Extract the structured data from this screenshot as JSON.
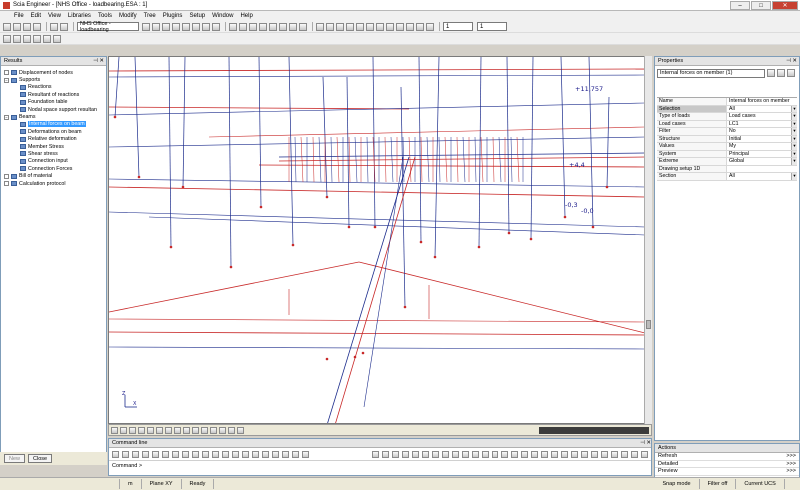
{
  "window": {
    "title": "Scia Engineer - [NHS Office - loadbearing.ESA : 1]",
    "min": "–",
    "max": "□",
    "close": "✕"
  },
  "menu": [
    "File",
    "Edit",
    "View",
    "Libraries",
    "Tools",
    "Modify",
    "Tree",
    "Plugins",
    "Setup",
    "Window",
    "Help"
  ],
  "toolbar": {
    "project_combo": "NHS Office - loadbearing",
    "spin1": "1",
    "spin2": "1"
  },
  "results_panel": {
    "title": "Results",
    "items": [
      {
        "label": "Displacement of nodes",
        "level": 0,
        "exp": ""
      },
      {
        "label": "Supports",
        "level": 0,
        "exp": "−"
      },
      {
        "label": "Reactions",
        "level": 1,
        "exp": ""
      },
      {
        "label": "Resultant of reactions",
        "level": 1,
        "exp": ""
      },
      {
        "label": "Foundation table",
        "level": 1,
        "exp": ""
      },
      {
        "label": "Nodal space support resultan",
        "level": 1,
        "exp": ""
      },
      {
        "label": "Beams",
        "level": 0,
        "exp": "−"
      },
      {
        "label": "Internal forces on beam",
        "level": 1,
        "exp": "",
        "selected": true
      },
      {
        "label": "Deformations on beam",
        "level": 1,
        "exp": ""
      },
      {
        "label": "Relative deformation",
        "level": 1,
        "exp": ""
      },
      {
        "label": "Member Stress",
        "level": 1,
        "exp": ""
      },
      {
        "label": "Shear stress",
        "level": 1,
        "exp": ""
      },
      {
        "label": "Connection input",
        "level": 1,
        "exp": ""
      },
      {
        "label": "Connection Forces",
        "level": 1,
        "exp": ""
      },
      {
        "label": "Bill of material",
        "level": 0,
        "exp": ""
      },
      {
        "label": "Calculation protocol",
        "level": 0,
        "exp": ""
      }
    ],
    "new_button": "New",
    "close_button": "Close"
  },
  "viewport": {
    "labels": [
      "+11,757",
      "-0,3",
      "-0,0",
      "+4,4"
    ],
    "axis_z": "Z",
    "axis_x": "X"
  },
  "command_line": {
    "title": "Command line",
    "prompt": "Command >"
  },
  "properties": {
    "title": "Properties",
    "selector": "Internal forces on member (1)",
    "rows": [
      {
        "key": "Name",
        "value": "Internal forces on member",
        "dd": false,
        "hl": false
      },
      {
        "key": "Selection",
        "value": "All",
        "dd": true,
        "hl": true
      },
      {
        "key": "Type of loads",
        "value": "Load cases",
        "dd": true,
        "hl": false
      },
      {
        "key": "Load cases",
        "value": "LC1",
        "dd": true,
        "hl": false
      },
      {
        "key": "Filter",
        "value": "No",
        "dd": true,
        "hl": false
      },
      {
        "key": "Structure",
        "value": "Initial",
        "dd": true,
        "hl": false
      },
      {
        "key": "Values",
        "value": "My",
        "dd": true,
        "hl": false
      },
      {
        "key": "System",
        "value": "Principal",
        "dd": true,
        "hl": false
      },
      {
        "key": "Extreme",
        "value": "Global",
        "dd": true,
        "hl": false
      },
      {
        "key": "Drawing setup 1D",
        "value": "",
        "dd": false,
        "hl": false
      },
      {
        "key": "Section",
        "value": "All",
        "dd": true,
        "hl": false
      }
    ]
  },
  "actions": {
    "title": "Actions",
    "rows": [
      {
        "label": "Refresh",
        "btn": ">>>"
      },
      {
        "label": "Detailed",
        "btn": ">>>"
      },
      {
        "label": "Preview",
        "btn": ">>>"
      }
    ]
  },
  "status": {
    "unit": "m",
    "plane": "Plane XY",
    "state": "Ready",
    "snap": "Snap mode",
    "filter": "Filter off",
    "ucs": "Current UCS"
  },
  "colors": {
    "accent": "#3399ff",
    "member_blue": "#1c2c8c",
    "force_red": "#c82828"
  }
}
